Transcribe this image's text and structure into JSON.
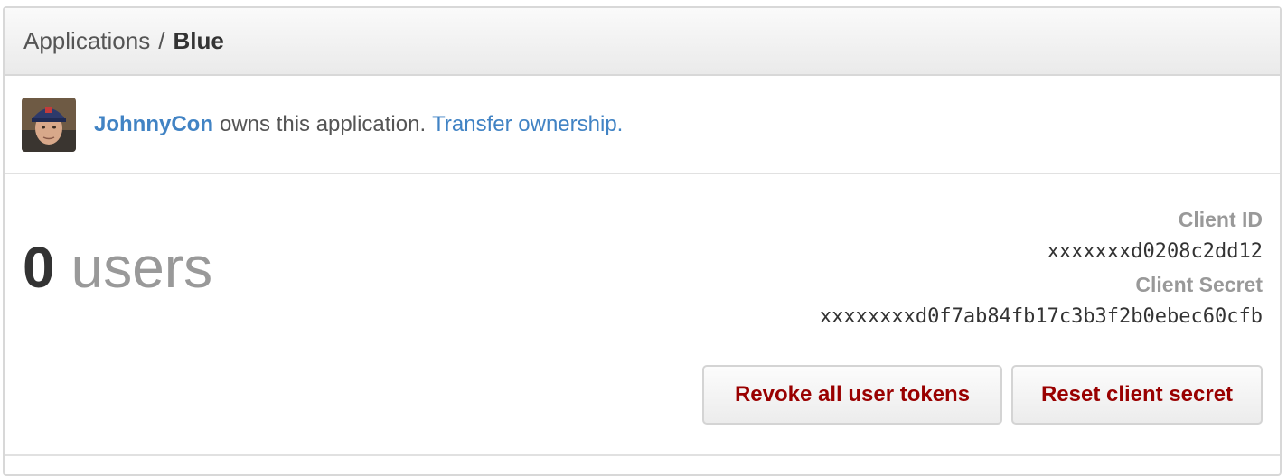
{
  "header": {
    "breadcrumb_parent": "Applications",
    "breadcrumb_separator": "/",
    "breadcrumb_current": "Blue"
  },
  "owner": {
    "username": "JohnnyCon",
    "owns_text": "owns this application.",
    "transfer_link": "Transfer ownership."
  },
  "stats": {
    "user_count": "0",
    "user_label": "users"
  },
  "credentials": {
    "client_id_label": "Client ID",
    "client_id_value": "xxxxxxxd0208c2dd12",
    "client_secret_label": "Client Secret",
    "client_secret_value": "xxxxxxxxd0f7ab84fb17c3b3f2b0ebec60cfb"
  },
  "actions": {
    "revoke_label": "Revoke all user tokens",
    "reset_label": "Reset client secret"
  },
  "colors": {
    "link": "#4183c4",
    "danger_text": "#990000",
    "muted": "#999999"
  }
}
